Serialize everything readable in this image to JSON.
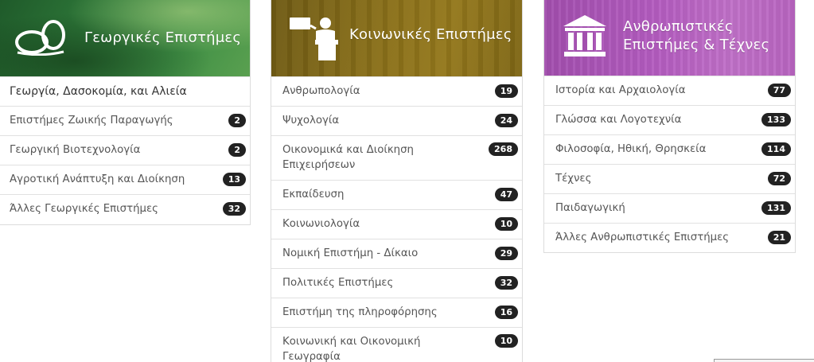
{
  "panels": [
    {
      "title": "Γεωργικές Επιστήμες",
      "icon": "seeds-icon",
      "accent": "#2f7a3a",
      "items": [
        {
          "label": "Γεωργία, Δασοκομία, και Αλιεία",
          "count": ""
        },
        {
          "label": "Επιστήμες Ζωικής Παραγωγής",
          "count": "2"
        },
        {
          "label": "Γεωργική Βιοτεχνολογία",
          "count": "2"
        },
        {
          "label": "Αγροτική Ανάπτυξη και Διοίκηση",
          "count": "13"
        },
        {
          "label": "Άλλες Γεωργικές Επιστήμες",
          "count": "32"
        }
      ]
    },
    {
      "title": "Κοινωνικές Επιστήμες",
      "icon": "speaker-podium-icon",
      "accent": "#8a7019",
      "items": [
        {
          "label": "Ανθρωπολογία",
          "count": "19"
        },
        {
          "label": "Ψυχολογία",
          "count": "24"
        },
        {
          "label": "Οικονομικά και Διοίκηση Επιχειρήσεων",
          "count": "268"
        },
        {
          "label": "Εκπαίδευση",
          "count": "47"
        },
        {
          "label": "Κοινωνιολογία",
          "count": "10"
        },
        {
          "label": "Νομική Επιστήμη - Δίκαιο",
          "count": "29"
        },
        {
          "label": "Πολιτικές Επιστήμες",
          "count": "32"
        },
        {
          "label": "Επιστήμη της πληροφόρησης",
          "count": "16"
        },
        {
          "label": "Κοινωνική και Οικονομική Γεωγραφία",
          "count": "10"
        }
      ]
    },
    {
      "title": "Ανθρωπιστικές Επιστήμες & Τέχνες",
      "icon": "classical-building-icon",
      "accent": "#b45cc0",
      "items": [
        {
          "label": "Ιστορία και Αρχαιολογία",
          "count": "77"
        },
        {
          "label": "Γλώσσα και Λογοτεχνία",
          "count": "133"
        },
        {
          "label": "Φιλοσοφία, Ηθική, Θρησκεία",
          "count": "114"
        },
        {
          "label": "Τέχνες",
          "count": "72"
        },
        {
          "label": "Παιδαγωγική",
          "count": "131"
        },
        {
          "label": "Άλλες Ανθρωπιστικές Επιστήμες",
          "count": "21"
        }
      ]
    }
  ]
}
